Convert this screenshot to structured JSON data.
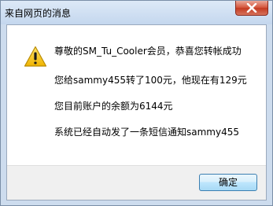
{
  "window": {
    "title": "来自网页的消息"
  },
  "message": {
    "lines": [
      "尊敬的SM_Tu_Cooler会员，恭喜您转帐成功",
      "您给sammy455转了100元，他现在有129元",
      "您目前账户的余额为6144元",
      "系统已经自动发了一条短信通知sammy455"
    ]
  },
  "footer": {
    "ok_label": "确定"
  },
  "icons": {
    "dialog_icon": "warning-icon",
    "close_icon": "close-icon"
  },
  "colors": {
    "close_button": "#c33a21",
    "warning_yellow": "#f5c518",
    "ok_button_border": "#3c7fb1"
  }
}
